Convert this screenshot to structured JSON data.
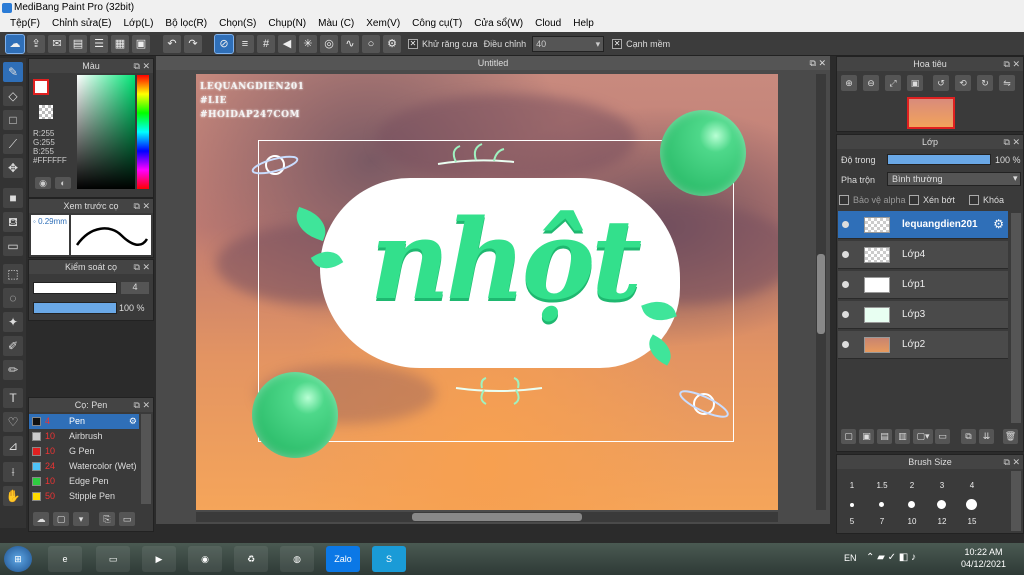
{
  "window": {
    "title": "MediBang Paint Pro (32bit)"
  },
  "menu": [
    "Tệp(F)",
    "Chỉnh sửa(E)",
    "Lớp(L)",
    "Bộ lọc(R)",
    "Chọn(S)",
    "Chụp(N)",
    "Màu (C)",
    "Xem(V)",
    "Công cụ(T)",
    "Cửa sổ(W)",
    "Cloud",
    "Help"
  ],
  "toolbar": {
    "antialias_label": "Khử răng cưa",
    "correction_label": "Điều chỉnh",
    "correction_value": "40",
    "snap_label": "Cạnh mềm"
  },
  "color_panel": {
    "title": "Màu",
    "r": "R:255",
    "g": "G:255",
    "b": "B:255",
    "hex": "#FFFFFF",
    "fg_color": "#ffffff",
    "accent": "#e02020"
  },
  "brush_preview": {
    "title": "Xem trước cọ",
    "size": "0.29mm"
  },
  "brush_control": {
    "title": "Kiểm soát cọ",
    "size_value": "4",
    "opacity_value": "100 %",
    "size_fraction": 0.92,
    "opacity_fraction": 1.0
  },
  "brush_list": {
    "title": "Cọ: Pen",
    "items": [
      {
        "size": "4",
        "name": "Pen",
        "color": "#111111",
        "selected": true
      },
      {
        "size": "10",
        "name": "Airbrush",
        "color": "#cccccc",
        "selected": false
      },
      {
        "size": "10",
        "name": "G Pen",
        "color": "#e02020",
        "selected": false
      },
      {
        "size": "24",
        "name": "Watercolor (Wet)",
        "color": "#4fc3f7",
        "selected": false
      },
      {
        "size": "10",
        "name": "Edge Pen",
        "color": "#2ecc40",
        "selected": false
      },
      {
        "size": "50",
        "name": "Stipple Pen",
        "color": "#ffdc00",
        "selected": false
      }
    ]
  },
  "canvas": {
    "doc_title": "Untitled",
    "watermark": [
      "LEQUANGDIEN201",
      "#LIE",
      "#HOIDAP247COM"
    ],
    "artwork_text": "nhột"
  },
  "navigator": {
    "title": "Hoa tiêu"
  },
  "layers": {
    "title": "Lớp",
    "opacity_label": "Độ trong",
    "opacity_value": "100 %",
    "opacity_fraction": 1.0,
    "blend_label": "Pha trộn",
    "blend_value": "Bình thường",
    "protect_alpha": "Bảo vệ alpha",
    "clip": "Xén bớt",
    "lock": "Khóa",
    "items": [
      {
        "name": "lequangdien201",
        "selected": true
      },
      {
        "name": "Lớp4",
        "selected": false
      },
      {
        "name": "Lớp1",
        "selected": false
      },
      {
        "name": "Lớp3",
        "selected": false
      },
      {
        "name": "Lớp2",
        "selected": false
      }
    ]
  },
  "brush_size": {
    "title": "Brush Size",
    "row1": [
      "1",
      "1.5",
      "2",
      "3",
      "4"
    ],
    "row2": [
      "5",
      "7",
      "10",
      "12",
      "15"
    ]
  },
  "taskbar": {
    "lang": "EN",
    "time": "10:22 AM",
    "date": "04/12/2021",
    "zalo": "Zalo"
  }
}
